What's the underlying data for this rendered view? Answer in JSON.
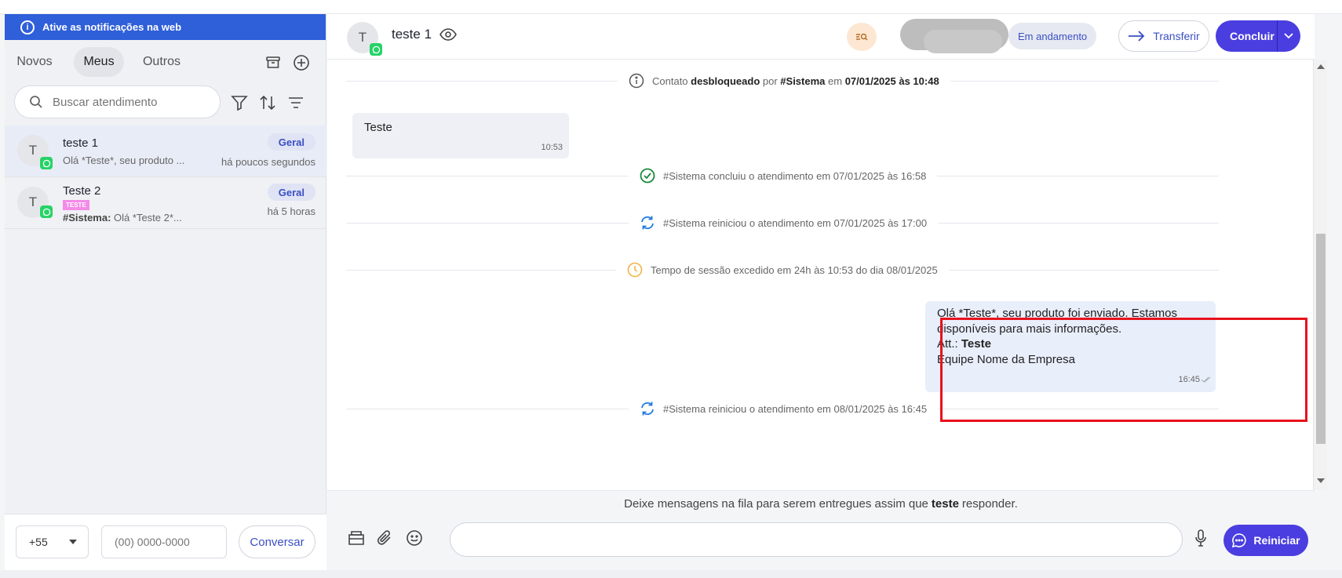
{
  "sidebar": {
    "banner": "Ative as notificações na web",
    "tabs": [
      "Novos",
      "Meus",
      "Outros"
    ],
    "search_placeholder": "Buscar atendimento",
    "conversations": [
      {
        "avatar": "T",
        "name": "teste 1",
        "preview": "Olá *Teste*, seu produto ...",
        "badge": "Geral",
        "time": "há poucos segundos"
      },
      {
        "avatar": "T",
        "name": "Teste 2",
        "tag": "TESTE",
        "preview_sender": "#Sistema:",
        "preview": "Olá *Teste 2*...",
        "badge": "Geral",
        "time": "há 5 horas"
      }
    ],
    "ddi": "+55",
    "phone_placeholder": "(00) 0000-0000",
    "conversar": "Conversar"
  },
  "chat": {
    "avatar": "T",
    "name": "teste 1",
    "status": "Em andamento",
    "transfer": "Transferir",
    "concluir": "Concluir",
    "messages": {
      "sys1": {
        "pre": "Contato ",
        "b1": "desbloqueado",
        "mid": " por ",
        "b2": "#Sistema",
        "mid2": " em ",
        "b3": "07/01/2025 às 10:48"
      },
      "in1": {
        "text": "Teste",
        "time": "10:53"
      },
      "sys2": "#Sistema concluiu o atendimento em 07/01/2025 às 16:58",
      "sys3": "#Sistema reiniciou o atendimento em 07/01/2025 às 17:00",
      "sys4": "Tempo de sessão excedido em 24h às 10:53 do dia 08/01/2025",
      "out1": {
        "line1": "Olá *Teste*, seu produto foi enviado. Estamos",
        "line2": "disponíveis para mais informações.",
        "line3_pre": "Att.: ",
        "line3_b": "Teste",
        "line4": "Equipe Nome da Empresa",
        "time": "16:45"
      },
      "sys5": "#Sistema reiniciou o atendimento em 08/01/2025 às 16:45"
    },
    "queue": {
      "pre": "Deixe mensagens na fila para serem entregues assim que",
      "b": "teste",
      "post": "responder."
    },
    "reiniciar": "Reiniciar"
  },
  "colors": {
    "primary": "#4a3ee0",
    "banner": "#2f5fd9",
    "whatsapp": "#25d366",
    "highlight": "#e8121c"
  }
}
